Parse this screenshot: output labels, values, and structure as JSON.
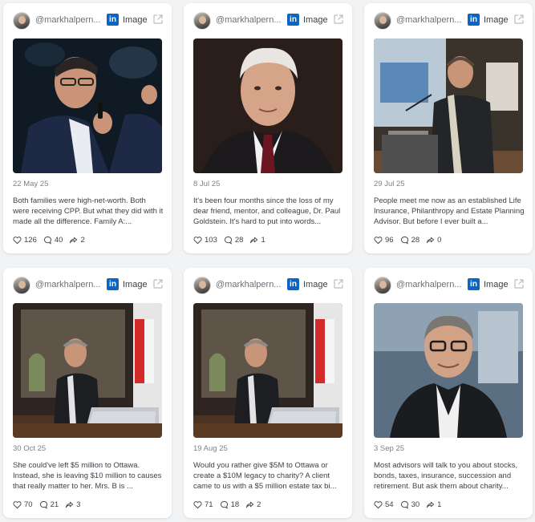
{
  "colors": {
    "linkedin": "#0a66c2",
    "background": "#f1f3f5"
  },
  "posts": [
    {
      "handle": "@markhalpern...",
      "platform_icon": "linkedin-icon",
      "type": "Image",
      "date": "22 May 25",
      "excerpt": "Both families were high-net-worth.   Both were receiving CPP.   But what they did with it made all the difference. Family A:...",
      "likes": "126",
      "comments": "40",
      "shares": "2"
    },
    {
      "handle": "@markhalpern...",
      "platform_icon": "linkedin-icon",
      "type": "Image",
      "date": "8 Jul 25",
      "excerpt": "It's been four months since the loss of my dear friend, mentor, and colleague, Dr. Paul Goldstein. It's hard to put into words...",
      "likes": "103",
      "comments": "28",
      "shares": "1"
    },
    {
      "handle": "@markhalpern...",
      "platform_icon": "linkedin-icon",
      "type": "Image",
      "date": "29 Jul 25",
      "excerpt": "People meet me now as an established Life Insurance, Philanthropy and Estate Planning Advisor. But before I ever built a...",
      "likes": "96",
      "comments": "28",
      "shares": "0"
    },
    {
      "handle": "@markhalpern...",
      "platform_icon": "linkedin-icon",
      "type": "Image",
      "date": "30 Oct 25",
      "excerpt": "She could've left $5 million to Ottawa. Instead, she is leaving $10 million to causes that really matter to her. Mrs. B is ...",
      "likes": "70",
      "comments": "21",
      "shares": "3"
    },
    {
      "handle": "@markhalpern...",
      "platform_icon": "linkedin-icon",
      "type": "Image",
      "date": "19 Aug 25",
      "excerpt": "Would you rather give $5M to Ottawa or create a $10M legacy to charity? A client came to us with a $5 million estate tax bi...",
      "likes": "71",
      "comments": "18",
      "shares": "2"
    },
    {
      "handle": "@markhalpern...",
      "platform_icon": "linkedin-icon",
      "type": "Image",
      "date": "3 Sep 25",
      "excerpt": "Most advisors will talk to you about stocks, bonds, taxes, insurance, succession and retirement. But ask them about charity...",
      "likes": "54",
      "comments": "30",
      "shares": "1"
    }
  ]
}
